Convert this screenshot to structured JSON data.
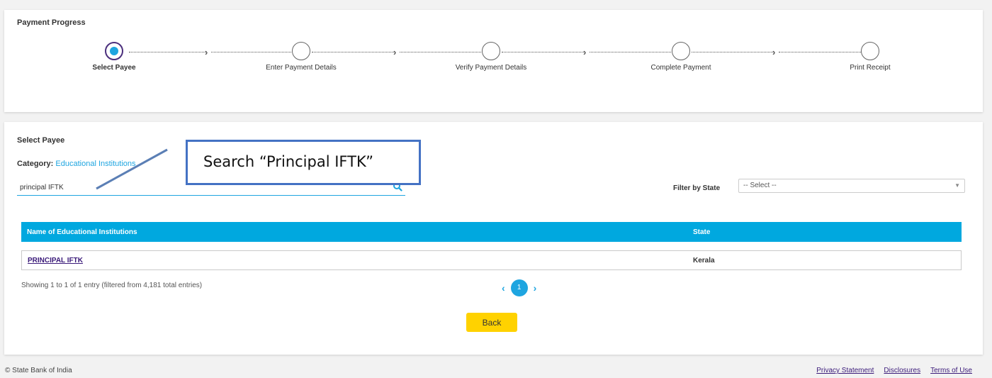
{
  "progress": {
    "title": "Payment Progress",
    "steps": [
      {
        "label": "Select Payee",
        "active": true
      },
      {
        "label": "Enter Payment Details",
        "active": false
      },
      {
        "label": "Verify Payment Details",
        "active": false
      },
      {
        "label": "Complete Payment",
        "active": false
      },
      {
        "label": "Print Receipt",
        "active": false
      }
    ]
  },
  "payee": {
    "title": "Select Payee",
    "category_label": "Category:",
    "category_value": "Educational Institutions",
    "search_value": "principal IFTK",
    "filter_label": "Filter by State",
    "filter_selected": "-- Select --",
    "table": {
      "headers": [
        "Name of Educational Institutions",
        "State"
      ],
      "rows": [
        [
          "PRINCIPAL IFTK",
          "Kerala"
        ]
      ]
    },
    "showing_text": "Showing 1 to 1 of 1 entry (filtered from 4,181 total entries)",
    "current_page": "1",
    "back_label": "Back"
  },
  "annotation": {
    "text": "Search “Principal IFTK”"
  },
  "footer": {
    "copyright": "© State Bank of India",
    "links": [
      "Privacy Statement",
      "Disclosures",
      "Terms of Use"
    ]
  },
  "colors": {
    "accent": "#00a8df",
    "button": "#ffd200",
    "active_ring": "#4b2f7d",
    "link": "#3b1b7a"
  },
  "icons": [
    "search-icon",
    "chevron-left-icon",
    "chevron-right-icon",
    "caret-down-icon",
    "arrow-right-icon"
  ]
}
